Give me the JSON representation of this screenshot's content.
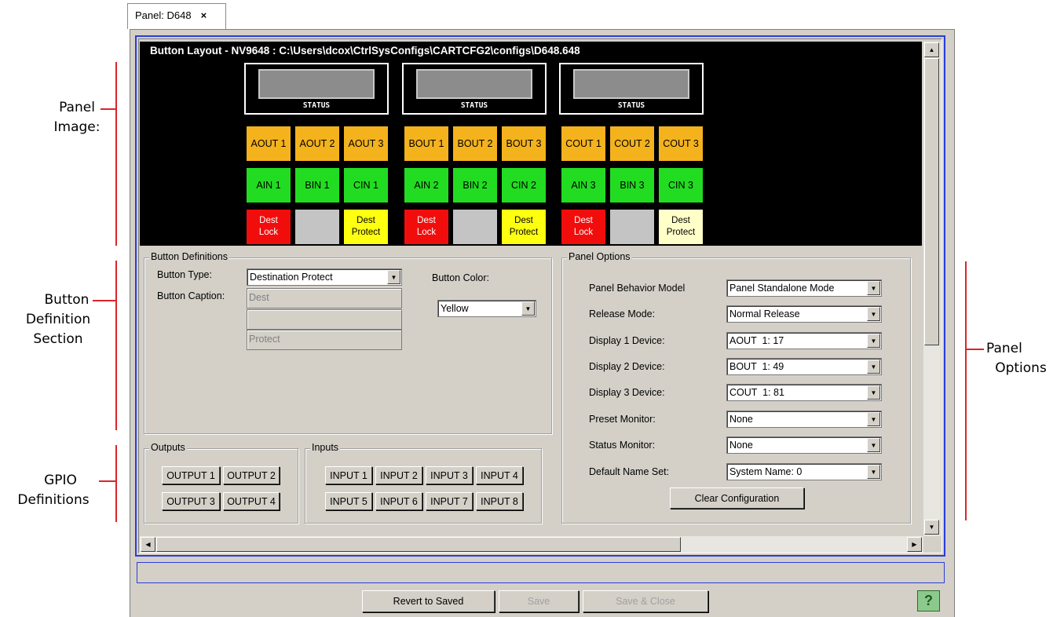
{
  "callouts": {
    "panel_image": [
      "Panel",
      "Image:"
    ],
    "button_definition": [
      "Button",
      "Definition",
      "Section"
    ],
    "gpio": [
      "GPIO",
      "Definitions"
    ],
    "panel_options": [
      "Panel",
      "Options"
    ]
  },
  "tab": {
    "label": "Panel: D648",
    "close": "×"
  },
  "panel_image": {
    "title": "Button Layout - NV9648 : C:\\Users\\dcox\\CtrlSysConfigs\\CARTCFG2\\configs\\D648.648",
    "status_label": "STATUS",
    "groups": [
      {
        "out": [
          "AOUT 1",
          "AOUT 2",
          "AOUT 3"
        ],
        "in": [
          "AIN 1",
          "BIN 1",
          "CIN 1"
        ],
        "lock": [
          "Dest",
          "Lock"
        ],
        "protect": [
          "Dest",
          "Protect"
        ]
      },
      {
        "out": [
          "BOUT 1",
          "BOUT 2",
          "BOUT 3"
        ],
        "in": [
          "AIN 2",
          "BIN 2",
          "CIN 2"
        ],
        "lock": [
          "Dest",
          "Lock"
        ],
        "protect": [
          "Dest",
          "Protect"
        ]
      },
      {
        "out": [
          "COUT 1",
          "COUT 2",
          "COUT 3"
        ],
        "in": [
          "AIN 3",
          "BIN 3",
          "CIN 3"
        ],
        "lock": [
          "Dest",
          "Lock"
        ],
        "protect": [
          "Dest",
          "Protect"
        ]
      }
    ]
  },
  "button_definitions": {
    "legend": "Button Definitions",
    "type_label": "Button Type:",
    "type_value": "Destination Protect",
    "caption_label": "Button Caption:",
    "caption_lines": [
      "Dest",
      "",
      "Protect"
    ],
    "color_label": "Button Color:",
    "color_value": "Yellow"
  },
  "outputs": {
    "legend": "Outputs",
    "buttons": [
      "OUTPUT 1",
      "OUTPUT 2",
      "OUTPUT 3",
      "OUTPUT 4"
    ]
  },
  "inputs": {
    "legend": "Inputs",
    "buttons": [
      "INPUT 1",
      "INPUT 2",
      "INPUT 3",
      "INPUT 4",
      "INPUT 5",
      "INPUT 6",
      "INPUT 7",
      "INPUT 8"
    ]
  },
  "panel_options": {
    "legend": "Panel Options",
    "rows": [
      {
        "label": "Panel Behavior Model",
        "value": "Panel Standalone Mode"
      },
      {
        "label": "Release Mode:",
        "value": "Normal Release"
      },
      {
        "label": "Display 1 Device:",
        "value": "AOUT  1: 17"
      },
      {
        "label": "Display 2 Device:",
        "value": "BOUT  1: 49"
      },
      {
        "label": "Display 3 Device:",
        "value": "COUT  1: 81"
      },
      {
        "label": "Preset Monitor:",
        "value": "None"
      },
      {
        "label": "Status Monitor:",
        "value": "None"
      },
      {
        "label": "Default Name Set:",
        "value": "System Name: 0"
      }
    ],
    "clear_button": "Clear Configuration"
  },
  "footer": {
    "revert": "Revert to Saved",
    "save": "Save",
    "save_close": "Save & Close",
    "help": "?"
  },
  "icons": {
    "combo_arrow": "▼",
    "scroll_up": "▲",
    "scroll_down": "▼",
    "scroll_left": "◀",
    "scroll_right": "▶"
  }
}
